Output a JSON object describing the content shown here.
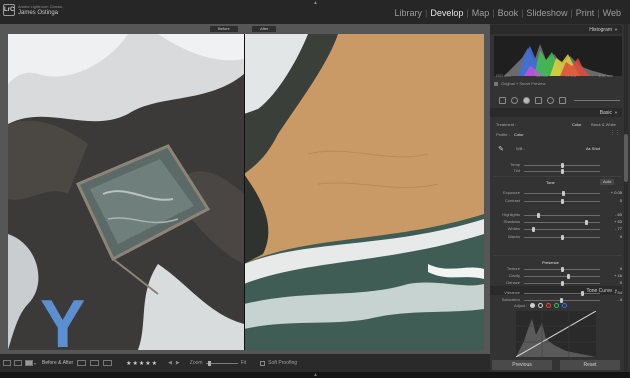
{
  "app": {
    "logo_text": "LrC",
    "product": "Adobe Lightroom Classic",
    "user": "James Ostinga"
  },
  "modules": [
    "Library",
    "Develop",
    "Map",
    "Book",
    "Slideshow",
    "Print",
    "Web"
  ],
  "active_module": "Develop",
  "view": {
    "before_label": "Before",
    "after_label": "After",
    "watermark": "Y"
  },
  "toolbar": {
    "compare_label": "Before & After",
    "rating": "★★★★★",
    "nav_prev": "◀",
    "nav_next": "▶",
    "zoom_label": "Zoom",
    "zoom_value": "Fit",
    "soft_proofing": "Soft Proofing"
  },
  "panel": {
    "histogram": {
      "title": "Histogram",
      "iso": "ISO 400",
      "focal": "15 mm",
      "aperture": "f / 4.5",
      "shutter": "1/30 sec",
      "source": "Original + Smart Preview"
    },
    "basic": {
      "title": "Basic",
      "treatment_label": "Treatment :",
      "color": "Color",
      "bw": "Black & White",
      "profile_label": "Profile :",
      "profile_value": "Color",
      "wb_label": "WB :",
      "wb_value": "As Shot",
      "tone_label": "Tone",
      "auto_label": "Auto",
      "presence_label": "Presence"
    },
    "sliders": [
      {
        "label": "Temp",
        "value": "",
        "pos": 0.5
      },
      {
        "label": "Tint",
        "value": "",
        "pos": 0.5
      },
      {
        "label": "Exposure",
        "value": "+ 0.05",
        "pos": 0.52
      },
      {
        "label": "Contrast",
        "value": "0",
        "pos": 0.5
      },
      {
        "label": "Highlights",
        "value": "- 63",
        "pos": 0.18
      },
      {
        "label": "Shadows",
        "value": "+ 63",
        "pos": 0.82
      },
      {
        "label": "Whites",
        "value": "- 77",
        "pos": 0.11
      },
      {
        "label": "Blacks",
        "value": "0",
        "pos": 0.5
      },
      {
        "label": "Texture",
        "value": "0",
        "pos": 0.5
      },
      {
        "label": "Clarity",
        "value": "+ 16",
        "pos": 0.58
      },
      {
        "label": "Dehaze",
        "value": "0",
        "pos": 0.5
      },
      {
        "label": "Vibrance",
        "value": "+ 54",
        "pos": 0.77
      },
      {
        "label": "Saturation",
        "value": "- 4",
        "pos": 0.48
      }
    ],
    "tone_curve": {
      "title": "Tone Curve",
      "adjust_label": "Adjust :"
    },
    "previous_button": "Previous",
    "reset_button": "Reset"
  },
  "colors": {
    "accent_watermark": "#5b8fd0",
    "panel_bg": "#333333",
    "topbar_bg": "#262626"
  }
}
